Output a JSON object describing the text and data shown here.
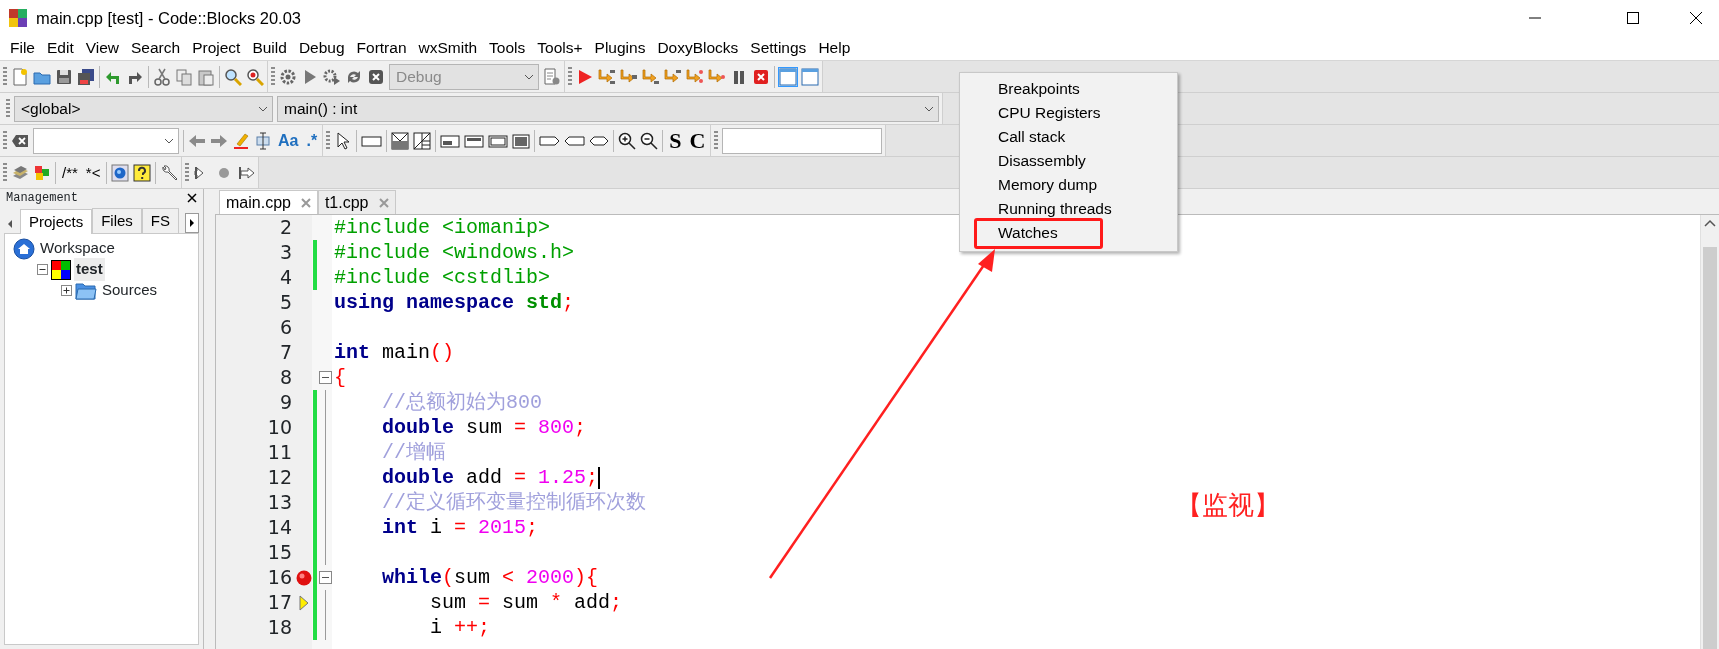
{
  "window": {
    "title": "main.cpp [test] - Code::Blocks 20.03"
  },
  "menu": [
    "File",
    "Edit",
    "View",
    "Search",
    "Project",
    "Build",
    "Debug",
    "Fortran",
    "wxSmith",
    "Tools",
    "Tools+",
    "Plugins",
    "DoxyBlocks",
    "Settings",
    "Help"
  ],
  "toolbar": {
    "build_target": {
      "value": "Debug",
      "disabled": true
    },
    "scope": "<global>",
    "symbol": "main() : int",
    "search_buttons": [
      "Aa",
      ".*"
    ],
    "style_buttons": [
      "S",
      "C"
    ],
    "doxy_buttons": [
      "/**",
      "*<"
    ]
  },
  "management": {
    "title": "Management",
    "tabs": [
      {
        "label": "Projects",
        "selected": true
      },
      {
        "label": "Files",
        "selected": false
      },
      {
        "label": "FS",
        "selected": false
      }
    ],
    "tree": [
      {
        "label": "Workspace",
        "kind": "workspace",
        "selected": false,
        "children": [
          {
            "label": "test",
            "kind": "project",
            "expanded": true,
            "selected": true,
            "children": [
              {
                "label": "Sources",
                "kind": "folder",
                "expanded": false,
                "selected": false
              }
            ]
          }
        ]
      }
    ]
  },
  "editor": {
    "tabs": [
      {
        "label": "main.cpp",
        "selected": true
      },
      {
        "label": "t1.cpp",
        "selected": false
      }
    ],
    "lines": [
      {
        "number": "2",
        "changed": false,
        "fold_start": false,
        "in_fold": false,
        "breakpoint": false,
        "current": false,
        "caret": false,
        "code": [
          {
            "text": "#include <iomanip>",
            "kind": "preprocessor"
          }
        ]
      },
      {
        "number": "3",
        "changed": true,
        "fold_start": false,
        "in_fold": false,
        "breakpoint": false,
        "current": false,
        "caret": false,
        "code": [
          {
            "text": "#include <windows.h>",
            "kind": "preprocessor"
          }
        ]
      },
      {
        "number": "4",
        "changed": true,
        "fold_start": false,
        "in_fold": false,
        "breakpoint": false,
        "current": false,
        "caret": false,
        "code": [
          {
            "text": "#include <cstdlib>",
            "kind": "preprocessor"
          }
        ]
      },
      {
        "number": "5",
        "changed": false,
        "fold_start": false,
        "in_fold": false,
        "breakpoint": false,
        "current": false,
        "caret": false,
        "code": [
          {
            "text": "using ",
            "kind": "keyword"
          },
          {
            "text": "namespace ",
            "kind": "keyword"
          },
          {
            "text": "std",
            "kind": "namespace"
          },
          {
            "text": ";",
            "kind": "operator"
          }
        ]
      },
      {
        "number": "6",
        "changed": false,
        "fold_start": false,
        "in_fold": false,
        "breakpoint": false,
        "current": false,
        "caret": false
      },
      {
        "number": "7",
        "changed": false,
        "fold_start": false,
        "in_fold": false,
        "breakpoint": false,
        "current": false,
        "caret": false,
        "code": [
          {
            "text": "int",
            "kind": "keyword"
          },
          {
            "text": " main",
            "kind": "plain"
          },
          {
            "text": "()",
            "kind": "operator"
          }
        ]
      },
      {
        "number": "8",
        "changed": false,
        "fold_start": true,
        "in_fold": false,
        "breakpoint": false,
        "current": false,
        "caret": false,
        "code": [
          {
            "text": "{",
            "kind": "operator"
          }
        ]
      },
      {
        "number": "9",
        "changed": true,
        "fold_start": false,
        "in_fold": true,
        "breakpoint": false,
        "current": false,
        "caret": false,
        "code": [
          {
            "text": "    //总额初始为800",
            "kind": "comment"
          }
        ]
      },
      {
        "number": "10",
        "changed": true,
        "fold_start": false,
        "in_fold": true,
        "breakpoint": false,
        "current": false,
        "caret": false,
        "code": [
          {
            "text": "    double",
            "kind": "keyword"
          },
          {
            "text": " sum ",
            "kind": "plain"
          },
          {
            "text": "= ",
            "kind": "operator"
          },
          {
            "text": "800",
            "kind": "number"
          },
          {
            "text": ";",
            "kind": "operator"
          }
        ]
      },
      {
        "number": "11",
        "changed": true,
        "fold_start": false,
        "in_fold": true,
        "breakpoint": false,
        "current": false,
        "caret": false,
        "code": [
          {
            "text": "    //增幅",
            "kind": "comment"
          }
        ]
      },
      {
        "number": "12",
        "changed": true,
        "fold_start": false,
        "in_fold": true,
        "breakpoint": false,
        "current": false,
        "caret": true,
        "code": [
          {
            "text": "    double",
            "kind": "keyword"
          },
          {
            "text": " add ",
            "kind": "plain"
          },
          {
            "text": "= ",
            "kind": "operator"
          },
          {
            "text": "1.25",
            "kind": "number"
          },
          {
            "text": ";",
            "kind": "operator"
          }
        ]
      },
      {
        "number": "13",
        "changed": true,
        "fold_start": false,
        "in_fold": true,
        "breakpoint": false,
        "current": false,
        "caret": false,
        "code": [
          {
            "text": "    //定义循环变量控制循环次数",
            "kind": "comment"
          }
        ]
      },
      {
        "number": "14",
        "changed": true,
        "fold_start": false,
        "in_fold": true,
        "breakpoint": false,
        "current": false,
        "caret": false,
        "code": [
          {
            "text": "    int",
            "kind": "keyword"
          },
          {
            "text": " i ",
            "kind": "plain"
          },
          {
            "text": "= ",
            "kind": "operator"
          },
          {
            "text": "2015",
            "kind": "number"
          },
          {
            "text": ";",
            "kind": "operator"
          }
        ]
      },
      {
        "number": "15",
        "changed": true,
        "fold_start": false,
        "in_fold": true,
        "breakpoint": false,
        "current": false,
        "caret": false
      },
      {
        "number": "16",
        "changed": true,
        "fold_start": true,
        "in_fold": false,
        "breakpoint": true,
        "current": false,
        "caret": false,
        "code": [
          {
            "text": "    while",
            "kind": "keyword"
          },
          {
            "text": "(",
            "kind": "operator"
          },
          {
            "text": "sum ",
            "kind": "plain"
          },
          {
            "text": "< ",
            "kind": "operator"
          },
          {
            "text": "2000",
            "kind": "number"
          },
          {
            "text": "){",
            "kind": "operator"
          }
        ]
      },
      {
        "number": "17",
        "changed": true,
        "fold_start": false,
        "in_fold": true,
        "breakpoint": false,
        "current": true,
        "caret": false,
        "code": [
          {
            "text": "        sum ",
            "kind": "plain"
          },
          {
            "text": "=",
            "kind": "operator"
          },
          {
            "text": " sum ",
            "kind": "plain"
          },
          {
            "text": "*",
            "kind": "operator"
          },
          {
            "text": " add",
            "kind": "plain"
          },
          {
            "text": ";",
            "kind": "operator"
          }
        ]
      },
      {
        "number": "18",
        "changed": true,
        "fold_start": false,
        "in_fold": true,
        "breakpoint": false,
        "current": false,
        "caret": false,
        "code": [
          {
            "text": "        i ",
            "kind": "plain"
          },
          {
            "text": "++;",
            "kind": "operator"
          }
        ]
      }
    ]
  },
  "popup_menu": {
    "items": [
      {
        "label": "Breakpoints",
        "boxed": false
      },
      {
        "label": "CPU Registers",
        "boxed": false
      },
      {
        "label": "Call stack",
        "boxed": false
      },
      {
        "label": "Disassembly",
        "boxed": false
      },
      {
        "label": "Memory dump",
        "boxed": false
      },
      {
        "label": "Running threads",
        "boxed": false
      },
      {
        "label": "Watches",
        "boxed": true
      }
    ]
  },
  "annotation": {
    "callout": "【监视】"
  }
}
